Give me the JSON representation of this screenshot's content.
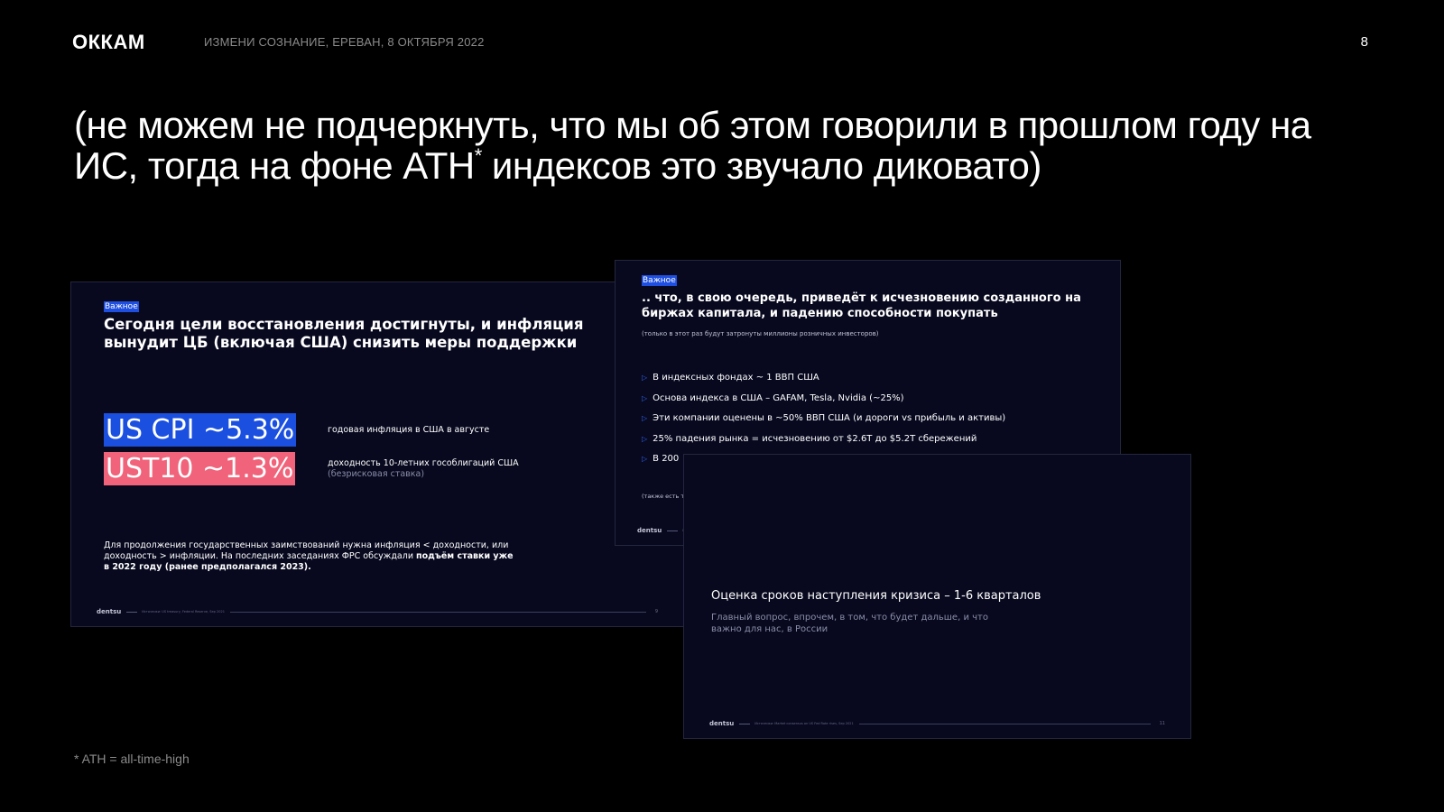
{
  "header": {
    "logo": "ОККАМ",
    "event": "ИЗМЕНИ СОЗНАНИЕ, ЕРЕВАН, 8 ОКТЯБРЯ 2022",
    "page_number": "8"
  },
  "headline": {
    "before_sup": "(не можем не подчеркнуть, что мы об этом говорили в прошлом году на ИС, тогда на фоне ATH",
    "sup": "*",
    "after_sup": " индексов это звучало диковато)"
  },
  "slide_a": {
    "tag": "Важное",
    "title": "Сегодня цели восстановления достигнуты, и инфляция вынудит ЦБ (включая США) снизить меры поддержки",
    "metric1": {
      "value": "US CPI ~5.3%",
      "caption": "годовая инфляция в США в августе",
      "color": "#1a4fe0"
    },
    "metric2": {
      "value": "UST10 ~1.3%",
      "caption": "доходность 10-летних гособлигаций США",
      "subcaption": "(безрисковая ставка)",
      "color": "#f0637a"
    },
    "para_normal": "Для продолжения государственных заимствований нужна инфляция < доходности, или доходность > инфляции. На последних заседаниях ФРС обсуждали ",
    "para_bold": "подъём ставки уже в 2022 году (ранее предполагался 2023).",
    "footer": {
      "brand": "dentsu",
      "source": "Источники: US treasury, Federal Reserve, Sep 2021",
      "page": "9"
    }
  },
  "slide_b": {
    "tag": "Важное",
    "title": ".. что, в свою очередь, приведёт к исчезновению созданного на биржах капитала, и падению способности покупать",
    "note": "(только в этот раз будут затронуты миллионы розничных инвесторов)",
    "bullets": [
      "В индексных фондах ~ 1 ВВП США",
      "Основа индекса в США – GAFAM, Tesla, Nvidia (~25%)",
      "Эти компании оценены в ~50% ВВП США (и дороги vs прибыль и активы)",
      "25% падения рынка = исчезновению от $2.6T  до $5.2T сбережений",
      "В 200"
    ],
    "bottom_note": "(также есть т",
    "footer": {
      "brand": "dentsu",
      "source": "Источники:",
      "page": ""
    }
  },
  "slide_c": {
    "title": "Оценка сроков наступления кризиса – 1-6 кварталов",
    "subtitle": "Главный вопрос, впрочем, в том, что будет дальше, и что важно для нас, в России",
    "footer": {
      "brand": "dentsu",
      "source": "Источники: Market consensus on US Fed Rate rises, Sep 2021",
      "page": "11"
    }
  },
  "footnote": "* ATH = all-time-high"
}
